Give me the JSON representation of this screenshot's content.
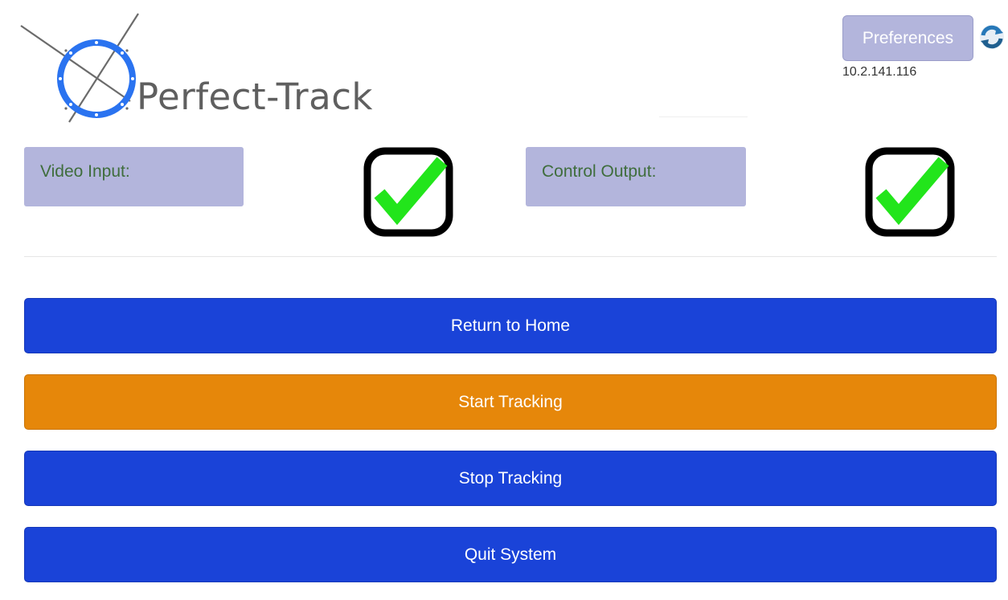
{
  "header": {
    "app_name": "Perfect-Track",
    "logo_icon": "crosshair-target-icon"
  },
  "preferences": {
    "label": "Preferences",
    "refresh_icon": "refresh-icon",
    "ip_address": "10.2.141.116"
  },
  "status": {
    "video_input": {
      "label": "Video Input:",
      "ok": true,
      "icon": "checkmark-icon"
    },
    "control_output": {
      "label": "Control Output:",
      "ok": true,
      "icon": "checkmark-icon"
    }
  },
  "actions": {
    "return_home": "Return to Home",
    "start_tracking": "Start Tracking",
    "stop_tracking": "Stop Tracking",
    "quit_system": "Quit System"
  },
  "colors": {
    "primary_blue": "#1a43d8",
    "active_orange": "#e6870a",
    "status_box": "#b3b5dc",
    "status_text": "#3f6d3c",
    "check_green": "#22e51b",
    "logo_blue": "#2a73f0"
  }
}
